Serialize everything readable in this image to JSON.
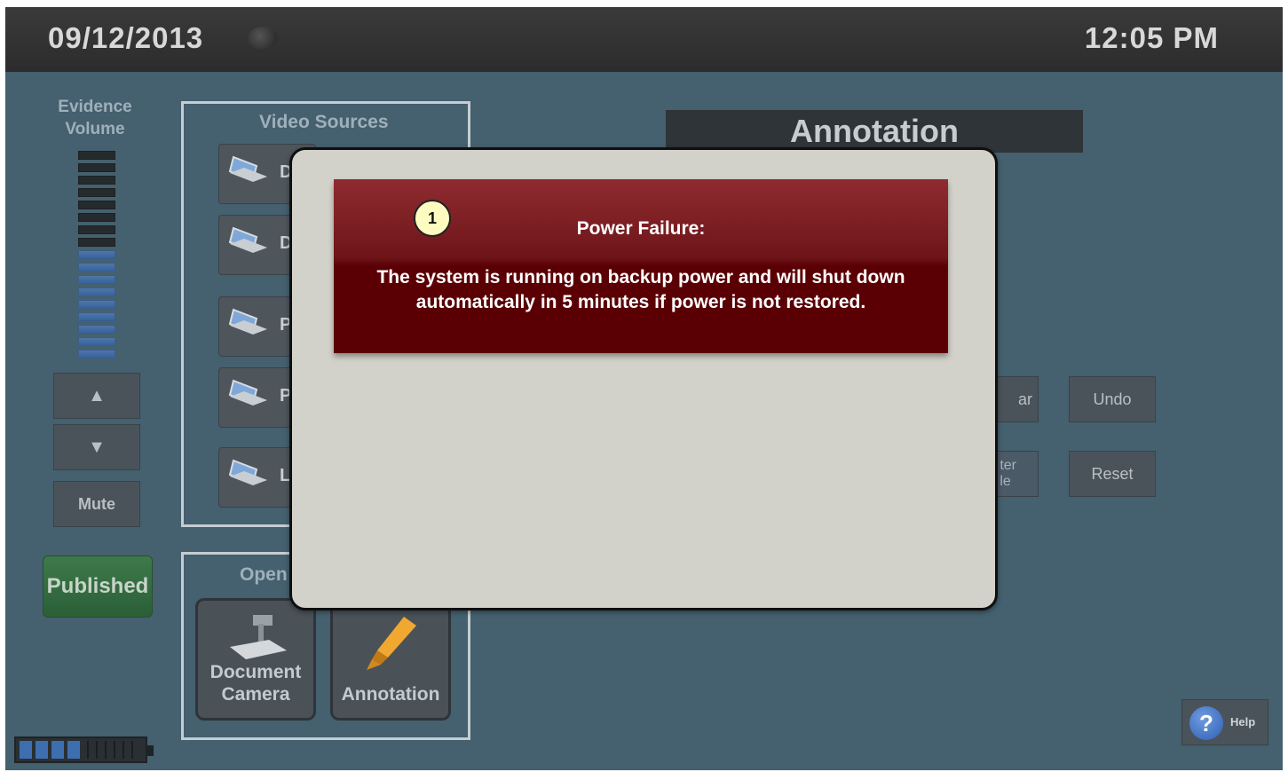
{
  "header": {
    "date": "09/12/2013",
    "time": "12:05 PM"
  },
  "volume": {
    "title_line1": "Evidence",
    "title_line2": "Volume",
    "up_icon": "triangle-up-icon",
    "down_icon": "triangle-down-icon",
    "up_label": "▲",
    "down_label": "▼",
    "mute_label": "Mute",
    "level_segments_total": 17,
    "level_segments_lit": 9
  },
  "published_label": "Published",
  "video_sources": {
    "title": "Video Sources",
    "items": [
      {
        "label": "D",
        "icon": "laptop-icon"
      },
      {
        "label": "D",
        "icon": "laptop-icon"
      },
      {
        "label": "P",
        "icon": "laptop-icon"
      },
      {
        "label": "P",
        "icon": "laptop-icon"
      },
      {
        "label": "L",
        "icon": "laptop-icon"
      }
    ]
  },
  "open_panel": {
    "title": "Open",
    "document_camera_line1": "Document",
    "document_camera_line2": "Camera",
    "annotation_label": "Annotation"
  },
  "annotation": {
    "title": "Annotation",
    "clear_partial": "ar",
    "undo_label": "Undo",
    "center_partial_line1": "ter",
    "center_partial_line2": "le",
    "reset_label": "Reset"
  },
  "help": {
    "label": "Help",
    "icon": "question-icon",
    "glyph": "?"
  },
  "battery": {
    "level_cells_lit": 4,
    "level_cells_total": 10
  },
  "dialog": {
    "badge": "1",
    "heading": "Power Failure:",
    "message": "The system is running on backup power and will shut down automatically in 5 minutes if power is not restored."
  },
  "colors": {
    "background": "#45606f",
    "topbar": "#2c2c2c",
    "alert_red": "#5a0004",
    "published_green": "#2b5f37",
    "dialog_bg": "#d3d2ca"
  }
}
